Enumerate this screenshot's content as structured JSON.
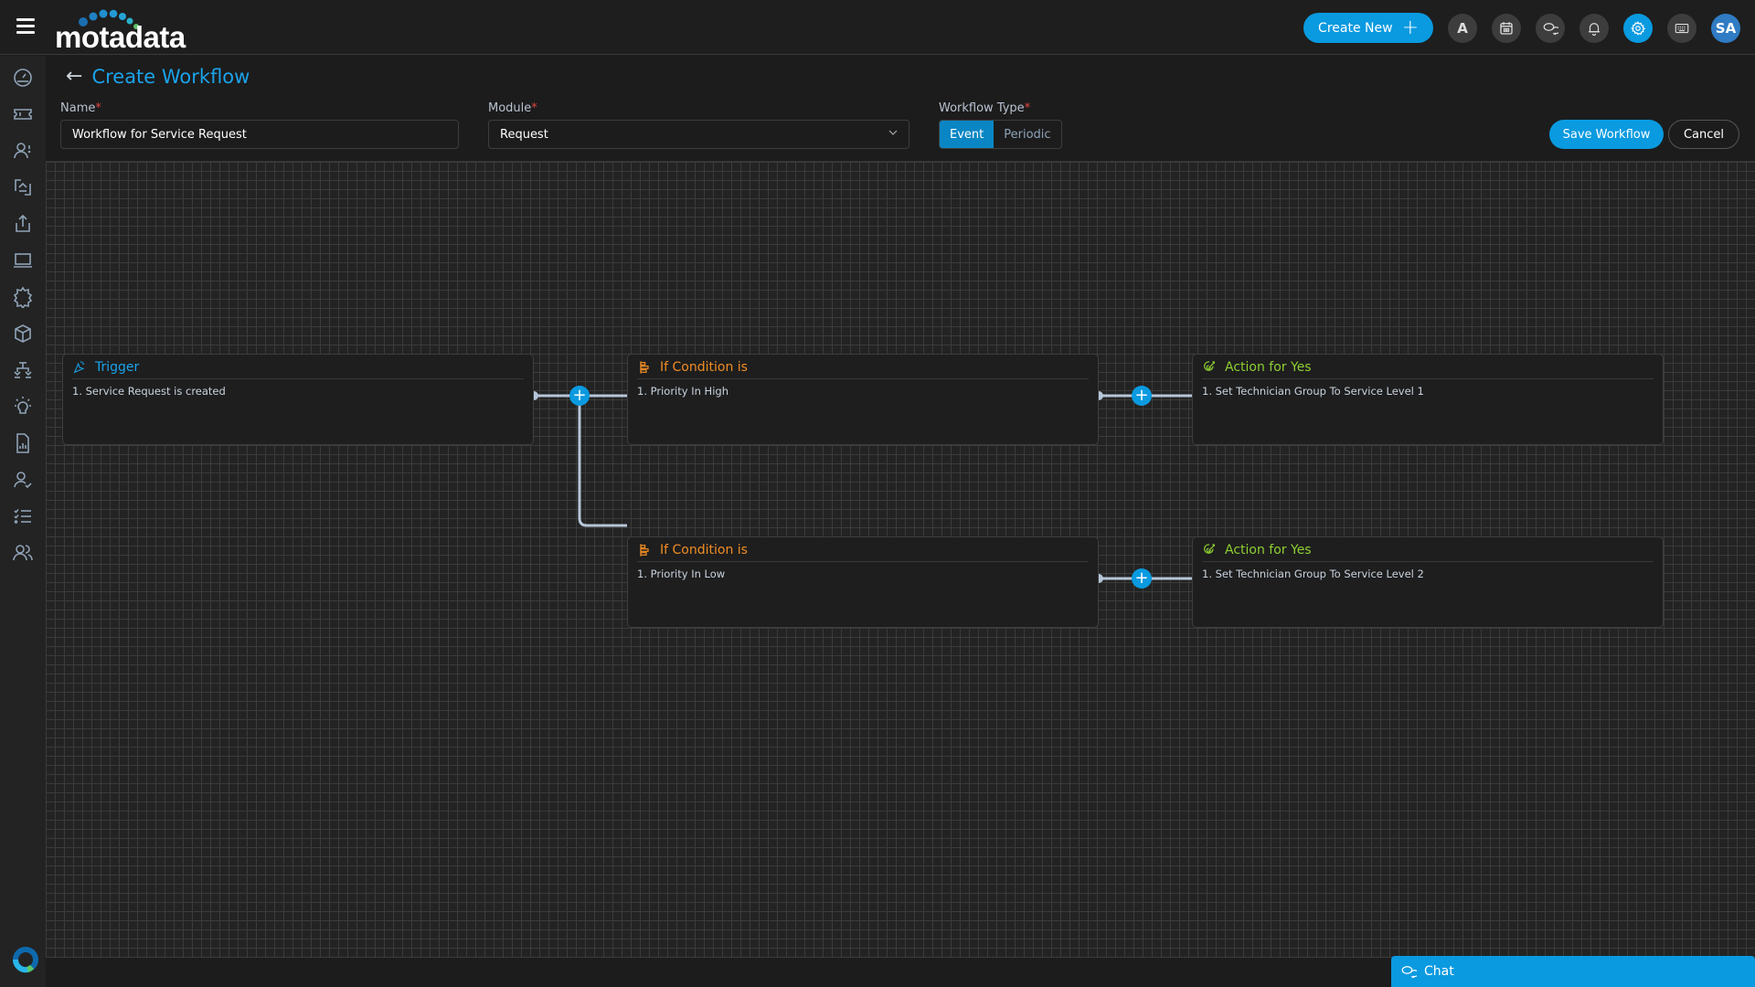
{
  "header": {
    "brand": "motadata",
    "create_new_label": "Create New",
    "icons": [
      "menu-icon",
      "text-a-icon",
      "calendar-icon",
      "chat-bubbles-icon",
      "bell-icon",
      "gear-icon",
      "keyboard-icon"
    ],
    "text_button_label": "A",
    "avatar_initials": "SA",
    "accent_color": "#0a9ae0"
  },
  "sidebar": {
    "items": [
      {
        "icon": "dashboard-icon"
      },
      {
        "icon": "ticket-icon"
      },
      {
        "icon": "user-request-icon"
      },
      {
        "icon": "change-icon"
      },
      {
        "icon": "release-icon"
      },
      {
        "icon": "asset-icon"
      },
      {
        "icon": "problem-icon"
      },
      {
        "icon": "cmdb-icon"
      },
      {
        "icon": "project-icon"
      },
      {
        "icon": "knowledge-icon"
      },
      {
        "icon": "report-icon"
      },
      {
        "icon": "user-approval-icon"
      },
      {
        "icon": "task-icon"
      },
      {
        "icon": "users-icon"
      }
    ]
  },
  "page": {
    "title": "Create Workflow",
    "name_label": "Name",
    "name_value": "Workflow for Service Request",
    "module_label": "Module",
    "module_value": "Request",
    "type_label": "Workflow Type",
    "required_mark": "*",
    "type_options": [
      "Event",
      "Periodic"
    ],
    "type_selected": "Event",
    "save_label": "Save Workflow",
    "cancel_label": "Cancel"
  },
  "workflow": {
    "nodes": [
      {
        "id": "trigger",
        "kind": "trigger",
        "title": "Trigger",
        "items": [
          "1. Service Request is created"
        ]
      },
      {
        "id": "cond-1",
        "kind": "condition",
        "title": "If Condition is",
        "items": [
          "1. Priority In High"
        ]
      },
      {
        "id": "action-1",
        "kind": "action",
        "title": "Action for Yes",
        "items": [
          "1. Set Technician Group To Service Level 1"
        ]
      },
      {
        "id": "cond-2",
        "kind": "condition",
        "title": "If Condition is",
        "items": [
          "1. Priority In Low"
        ]
      },
      {
        "id": "action-2",
        "kind": "action",
        "title": "Action for Yes",
        "items": [
          "1. Set Technician Group To Service Level 2"
        ]
      }
    ],
    "edges": [
      [
        "trigger",
        "cond-1"
      ],
      [
        "trigger",
        "cond-2"
      ],
      [
        "cond-1",
        "action-1"
      ],
      [
        "cond-2",
        "action-2"
      ]
    ],
    "colors": {
      "trigger": "#1aa3ea",
      "condition": "#f08c24",
      "action": "#8ecf32"
    }
  },
  "chat": {
    "label": "Chat"
  }
}
